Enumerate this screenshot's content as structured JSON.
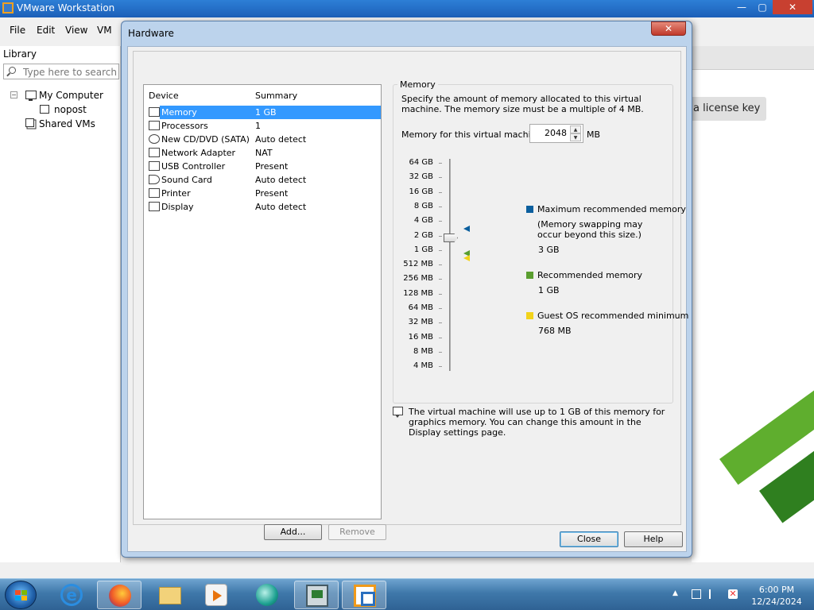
{
  "app": {
    "title": "VMware Workstation",
    "menu": [
      "File",
      "Edit",
      "View",
      "VM"
    ],
    "window_buttons": {
      "minimize": "—",
      "maximize": "▢",
      "close": "✕"
    }
  },
  "library": {
    "title": "Library",
    "search_placeholder": "Type here to search",
    "tree": {
      "my_computer": "My Computer",
      "vm": "nopost",
      "shared": "Shared VMs",
      "toggle": "−"
    }
  },
  "right_panel": {
    "license_button": "a license key"
  },
  "dialog": {
    "title": "Hardware",
    "close_glyph": "✕",
    "device_list": {
      "col_device": "Device",
      "col_summary": "Summary",
      "rows": [
        {
          "device": "Memory",
          "summary": "1 GB",
          "selected": true
        },
        {
          "device": "Processors",
          "summary": "1"
        },
        {
          "device": "New CD/DVD (SATA)",
          "summary": "Auto detect"
        },
        {
          "device": "Network Adapter",
          "summary": "NAT"
        },
        {
          "device": "USB Controller",
          "summary": "Present"
        },
        {
          "device": "Sound Card",
          "summary": "Auto detect"
        },
        {
          "device": "Printer",
          "summary": "Present"
        },
        {
          "device": "Display",
          "summary": "Auto detect"
        }
      ]
    },
    "add_button": "Add...",
    "remove_button": "Remove",
    "memory": {
      "group_title": "Memory",
      "description": "Specify the amount of memory allocated to this virtual machine. The memory size must be a multiple of 4 MB.",
      "field_label": "Memory for this virtual machine:",
      "value": "2048",
      "unit": "MB",
      "scale": [
        "64 GB",
        "32 GB",
        "16 GB",
        "8 GB",
        "4 GB",
        "2 GB",
        "1 GB",
        "512 MB",
        "256 MB",
        "128 MB",
        "64 MB",
        "32 MB",
        "16 MB",
        "8 MB",
        "4 MB"
      ],
      "legend": {
        "max_title": "Maximum recommended memory",
        "max_note_1": "(Memory swapping may",
        "max_note_2": "occur beyond this size.)",
        "max_value": "3 GB",
        "rec_title": "Recommended memory",
        "rec_value": "1 GB",
        "min_title": "Guest OS recommended minimum",
        "min_value": "768 MB"
      },
      "colors": {
        "max": "#0b5f9e",
        "recommended": "#5a9e2f",
        "minimum": "#f2d31b"
      }
    },
    "info_text": "The virtual machine will use up to 1 GB of this memory for graphics memory. You can change this amount in the Display settings page.",
    "close_button": "Close",
    "help_button": "Help"
  },
  "taskbar": {
    "time": "6:00 PM",
    "date": "12/24/2024"
  }
}
